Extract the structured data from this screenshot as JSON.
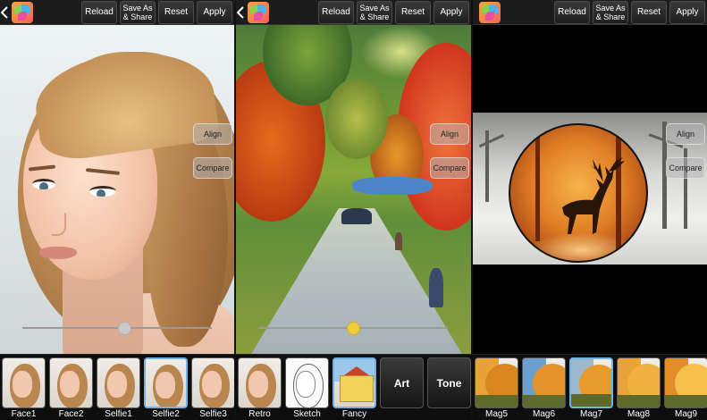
{
  "toolbar": {
    "reload": "Reload",
    "save_share": "Save As\n& Share",
    "reset": "Reset",
    "apply": "Apply"
  },
  "side_buttons": {
    "align": "Align",
    "compare": "Compare"
  },
  "panels": [
    {
      "slider_value": 0.55,
      "thumbnails": [
        "Face1",
        "Face2",
        "Selfie1",
        "Selfie2",
        "Selfie3"
      ],
      "selected": "Selfie2"
    },
    {
      "slider_value": 0.5,
      "thumbnails": [
        "Retro",
        "Sketch",
        "Fancy",
        "Art",
        "Tone"
      ],
      "selected": "Fancy",
      "tile_labels": {
        "art": "Art",
        "tone": "Tone"
      }
    },
    {
      "thumbnails": [
        "Mag5",
        "Mag6",
        "Mag7",
        "Mag8",
        "Mag9"
      ],
      "selected": "Mag7"
    }
  ],
  "colors": {
    "accent_selected": "#6fb3e3",
    "slider_knob_art": "#f0cd38"
  },
  "icons": [
    "back-chevron-icon",
    "app-logo-icon"
  ]
}
